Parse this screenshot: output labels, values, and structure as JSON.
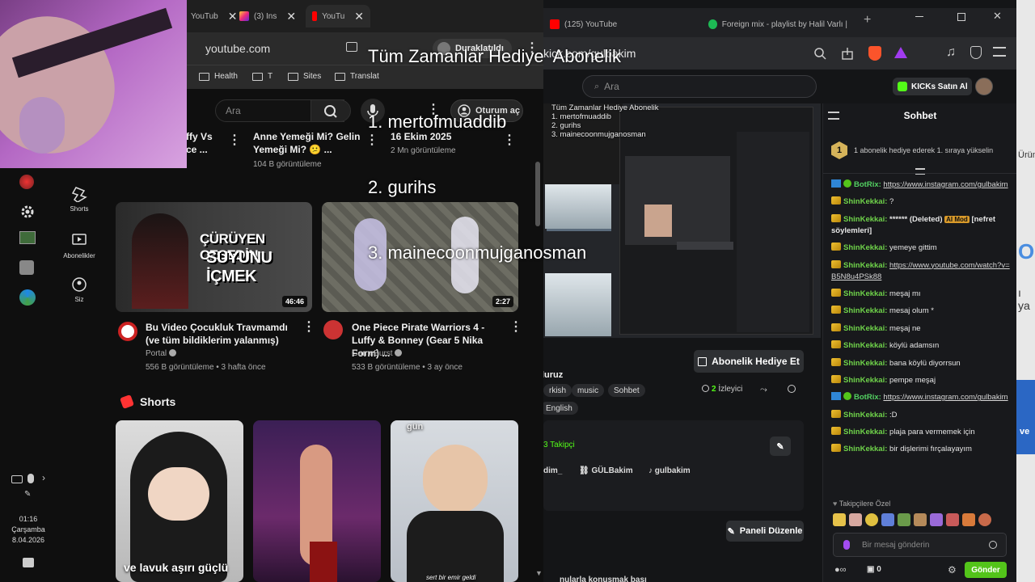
{
  "overlay": {
    "title": "Tüm Zamanlar Hediye  Abonelik",
    "lines": [
      "1. mertofmuaddib",
      "2. gurihs",
      "3. mainecoonmujganosman"
    ]
  },
  "youtube": {
    "tabs": [
      {
        "label": "YouTub"
      },
      {
        "label": "(3) Ins"
      },
      {
        "label": "YouTu"
      }
    ],
    "address": "youtube.com",
    "paused_label": "Duraklatıldı",
    "bookmarks": [
      "Health",
      "T",
      "Sites",
      "Translat"
    ],
    "search_placeholder": "Ara",
    "signin_label": "Oturum aç",
    "nav": [
      {
        "label": "Shorts"
      },
      {
        "label": "Abonelikler"
      },
      {
        "label": "Siz"
      }
    ],
    "clock": {
      "time": "01:16",
      "day": "Çarşamba",
      "date": "8.04.2026"
    },
    "top_row": [
      {
        "title": "ffy Vs\nce ...",
        "meta": ""
      },
      {
        "title": "Anne Yemeği Mi? Gelin Yemeği Mi? 😕 ...",
        "meta": "104 B görüntüleme"
      },
      {
        "title": "16 Ekim 2025",
        "meta": "2 Mn görüntüleme"
      }
    ],
    "videos": [
      {
        "thumb_text_1": "ÇÜRÜYEN CESEDİN",
        "thumb_text_2": "SUYUNU İÇMEK",
        "duration": "46:46",
        "title": "Bu Video Çocukluk Travmamdı (ve tüm bildiklerim yalanmış)",
        "channel": "Portal",
        "meta": "556 B görüntüleme • 3 hafta önce"
      },
      {
        "duration": "2:27",
        "title": "One Piece Pirate Warriors 4 - Luffy & Bonney (Gear 5 Nika Form) ...",
        "channel": "GameBurst",
        "meta": "533 B görüntüleme • 3 ay önce"
      }
    ],
    "shorts_heading": "Shorts",
    "shorts": [
      {
        "caption": "ve lavuk aşırı güçlü"
      },
      {
        "caption": ""
      },
      {
        "caption": "sert bir emir geldi",
        "top_text": "gün"
      }
    ]
  },
  "kick": {
    "tabs": [
      {
        "label": "(125) YouTube"
      },
      {
        "label": "Foreign mix - playlist by Halil Varlı | Spo"
      }
    ],
    "address": "kick.com/gulbakim",
    "search_placeholder": "Ara",
    "buy_label": "KICKs Satın Al",
    "gift_button": "Abonelik Hediye Et",
    "streamer_name": "luruz",
    "viewers_count": "2",
    "viewers_label": "İzleyici",
    "tags": [
      "rkish",
      "music",
      "Sohbet",
      "English"
    ],
    "followers_label": "3 Takipçi",
    "socials": [
      "dim_",
      "GÜLBakim",
      "gulbakim"
    ],
    "edit_panels": "Paneli Düzenle",
    "bottom_text": "nularla konuşmak başı",
    "chat": {
      "title": "Sohbet",
      "pinned": "1 abonelik hediye ederek 1. sıraya yükselin",
      "followers_only": "Takipçilere Özel",
      "input_placeholder": "Bir mesaj gönderin",
      "send_label": "Gönder",
      "counter": "0",
      "messages": [
        {
          "user": "BotRix:",
          "bot": true,
          "text": "https://www.instagram.com/gulbakim",
          "link": true
        },
        {
          "user": "ShinKekkai:",
          "text": "?"
        },
        {
          "user": "ShinKekkai:",
          "text_pre": "****** (Deleted) ",
          "mod": "AI Mod",
          "text": " [nefret söylemleri]"
        },
        {
          "user": "ShinKekkai:",
          "text": "yemeye gittim"
        },
        {
          "user": "ShinKekkai:",
          "text": "https://www.youtube.com/watch?v=B5N8u4PSk88",
          "link": true
        },
        {
          "user": "ShinKekkai:",
          "text": "meşaj mı"
        },
        {
          "user": "ShinKekkai:",
          "text": "mesaj olum *"
        },
        {
          "user": "ShinKekkai:",
          "text": "meşaj ne"
        },
        {
          "user": "ShinKekkai:",
          "text": "köylü adamsın"
        },
        {
          "user": "ShinKekkai:",
          "text": "bana köylü diyorrsun"
        },
        {
          "user": "ShinKekkai:",
          "text": "pempe meşaj"
        },
        {
          "user": "BotRix:",
          "bot": true,
          "text": "https://www.instagram.com/gulbakim",
          "link": true
        },
        {
          "user": "ShinKekkai:",
          "text": ":D"
        },
        {
          "user": "ShinKekkai:",
          "text": "plaja para vermemek için"
        },
        {
          "user": "ShinKekkai:",
          "text": "bir dişlerimi fırçalayayım"
        }
      ]
    },
    "preview": {
      "title": "Tüm Zamanlar Hediye  Abonelik",
      "lines": [
        "1. mertofmuaddib",
        "2. gurihs",
        "3. mainecoonmujganosman"
      ]
    }
  },
  "right_edge": [
    "Ürün",
    "O",
    "ı ya",
    "ve"
  ],
  "colors": {
    "youtube_red": "#ff0000",
    "kick_green": "#53fc18",
    "chat_user": "#6fd34a",
    "bg_dark": "#0f0f0f"
  }
}
